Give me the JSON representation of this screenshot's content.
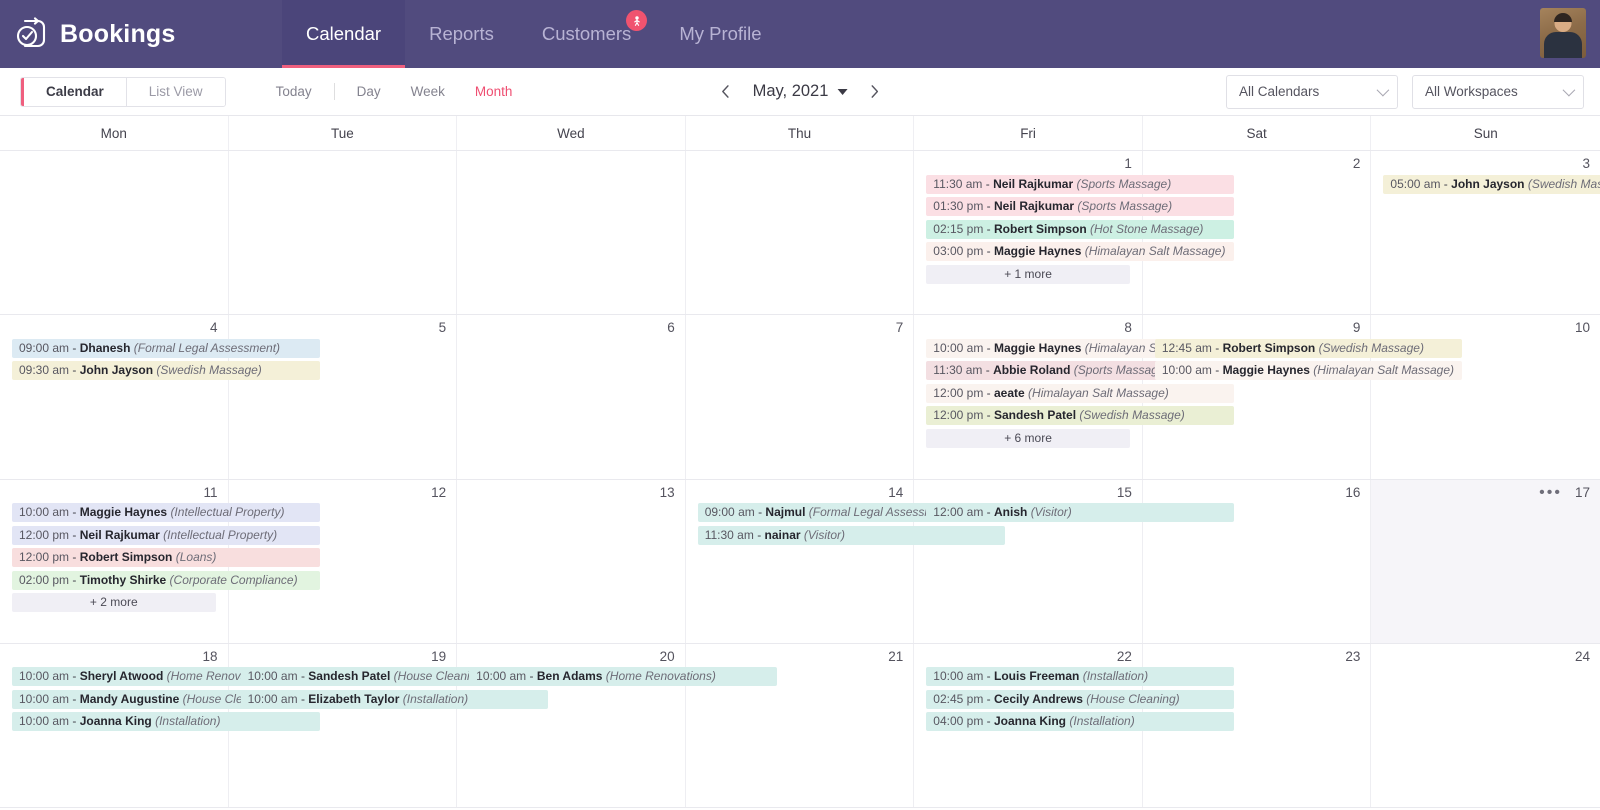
{
  "brand": {
    "title": "Bookings",
    "logo_icon": "clock-check-icon"
  },
  "nav": {
    "items": [
      {
        "label": "Calendar",
        "active": true
      },
      {
        "label": "Reports",
        "active": false
      },
      {
        "label": "Customers",
        "active": false,
        "badge_icon": "person-badge-icon"
      },
      {
        "label": "My Profile",
        "active": false
      }
    ],
    "avatar_icon": "user-avatar-photo",
    "accent": "#ef5f7e",
    "background": "#514b7e"
  },
  "toolbar": {
    "segments": [
      {
        "label": "Calendar",
        "active": true
      },
      {
        "label": "List View",
        "active": false
      }
    ],
    "today_label": "Today",
    "views": [
      {
        "label": "Day",
        "current": false
      },
      {
        "label": "Week",
        "current": false
      },
      {
        "label": "Month",
        "current": true
      }
    ],
    "prev_icon": "chevron-left-icon",
    "next_icon": "chevron-right-icon",
    "date_label": "May, 2021",
    "date_caret_icon": "caret-down-icon",
    "calendar_filter": "All Calendars",
    "workspace_filter": "All Workspaces"
  },
  "calendar": {
    "day_headers": [
      "Mon",
      "Tue",
      "Wed",
      "Thu",
      "Fri",
      "Sat",
      "Sun"
    ],
    "weeks": [
      [
        {
          "num": "",
          "events": []
        },
        {
          "num": "",
          "events": []
        },
        {
          "num": "",
          "events": []
        },
        {
          "num": "",
          "events": []
        },
        {
          "num": "1",
          "events": [
            {
              "time": "11:30 am",
              "name": "Neil Rajkumar",
              "service": "(Sports Massage)",
              "color": "c-pink"
            },
            {
              "time": "01:30 pm",
              "name": "Neil Rajkumar",
              "service": "(Sports Massage)",
              "color": "c-pink"
            },
            {
              "time": "02:15 pm",
              "name": "Robert Simpson",
              "service": "(Hot Stone Massage)",
              "color": "c-mint"
            },
            {
              "time": "03:00 pm",
              "name": "Maggie Haynes",
              "service": "(Himalayan Salt Massage)",
              "color": "c-blush"
            }
          ],
          "more": "+ 1 more"
        },
        {
          "num": "2",
          "events": []
        },
        {
          "num": "3",
          "events": [
            {
              "time": "05:00 am",
              "name": "John Jayson",
              "service": "(Swedish Massage)",
              "color": "c-khaki"
            }
          ]
        }
      ],
      [
        {
          "num": "4",
          "events": [
            {
              "time": "09:00 am",
              "name": "Dhanesh",
              "service": "(Formal Legal Assessment)",
              "color": "c-blue"
            },
            {
              "time": "09:30 am",
              "name": "John Jayson",
              "service": "(Swedish Massage)",
              "color": "c-khaki"
            }
          ]
        },
        {
          "num": "5",
          "events": []
        },
        {
          "num": "6",
          "events": []
        },
        {
          "num": "7",
          "events": []
        },
        {
          "num": "8",
          "events": [
            {
              "time": "10:00 am",
              "name": "Maggie Haynes",
              "service": "(Himalayan Salt Massage)",
              "color": "c-cream"
            },
            {
              "time": "11:30 am",
              "name": "Abbie Roland",
              "service": "(Sports Massage)",
              "color": "c-rose"
            },
            {
              "time": "12:00 pm",
              "name": "aeate",
              "service": "(Himalayan Salt Massage)",
              "color": "c-cream"
            },
            {
              "time": "12:00 pm",
              "name": "Sandesh Patel",
              "service": "(Swedish Massage)",
              "color": "c-olive"
            }
          ],
          "more": "+ 6 more"
        },
        {
          "num": "9",
          "events": [
            {
              "time": "12:45 am",
              "name": "Robert Simpson",
              "service": "(Swedish Massage)",
              "color": "c-khaki"
            },
            {
              "time": "10:00 am",
              "name": "Maggie Haynes",
              "service": "(Himalayan Salt Massage)",
              "color": "c-cream"
            }
          ]
        },
        {
          "num": "10",
          "events": []
        }
      ],
      [
        {
          "num": "11",
          "events": [
            {
              "time": "10:00 am",
              "name": "Maggie Haynes",
              "service": "(Intellectual Property)",
              "color": "c-lav"
            },
            {
              "time": "12:00 pm",
              "name": "Neil Rajkumar",
              "service": "(Intellectual Property)",
              "color": "c-lav"
            },
            {
              "time": "12:00 pm",
              "name": "Robert Simpson",
              "service": "(Loans)",
              "color": "c-red"
            },
            {
              "time": "02:00 pm",
              "name": "Timothy Shirke",
              "service": "(Corporate Compliance)",
              "color": "c-green"
            }
          ],
          "more": "+ 2 more"
        },
        {
          "num": "12",
          "events": []
        },
        {
          "num": "13",
          "events": []
        },
        {
          "num": "14",
          "events": [
            {
              "time": "09:00 am",
              "name": "Najmul",
              "service": "(Formal Legal Assessment)",
              "color": "c-teal"
            },
            {
              "time": "11:30 am",
              "name": "nainar",
              "service": "(Visitor)",
              "color": "c-teal"
            }
          ]
        },
        {
          "num": "15",
          "events": [
            {
              "time": "12:00 am",
              "name": "Anish",
              "service": "(Visitor)",
              "color": "c-teal"
            }
          ]
        },
        {
          "num": "16",
          "events": []
        },
        {
          "num": "17",
          "events": [],
          "highlight": true,
          "dots": "•••"
        }
      ],
      [
        {
          "num": "18",
          "events": [
            {
              "time": "10:00 am",
              "name": "Sheryl Atwood",
              "service": "(Home Renovation)",
              "color": "c-teal"
            },
            {
              "time": "10:00 am",
              "name": "Mandy Augustine",
              "service": "(House Cleaning)",
              "color": "c-teal"
            },
            {
              "time": "10:00 am",
              "name": "Joanna King",
              "service": "(Installation)",
              "color": "c-teal"
            }
          ]
        },
        {
          "num": "19",
          "events": [
            {
              "time": "10:00 am",
              "name": "Sandesh Patel",
              "service": "(House Cleaning)",
              "color": "c-teal"
            },
            {
              "time": "10:00 am",
              "name": "Elizabeth Taylor",
              "service": "(Installation)",
              "color": "c-teal"
            }
          ]
        },
        {
          "num": "20",
          "events": [
            {
              "time": "10:00 am",
              "name": "Ben Adams",
              "service": "(Home Renovations)",
              "color": "c-teal"
            }
          ]
        },
        {
          "num": "21",
          "events": []
        },
        {
          "num": "22",
          "events": [
            {
              "time": "10:00 am",
              "name": "Louis Freeman",
              "service": "(Installation)",
              "color": "c-teal"
            },
            {
              "time": "02:45 pm",
              "name": "Cecily Andrews",
              "service": "(House Cleaning)",
              "color": "c-teal"
            },
            {
              "time": "04:00 pm",
              "name": "Joanna King",
              "service": "(Installation)",
              "color": "c-teal"
            }
          ]
        },
        {
          "num": "23",
          "events": []
        },
        {
          "num": "24",
          "events": []
        }
      ]
    ]
  }
}
